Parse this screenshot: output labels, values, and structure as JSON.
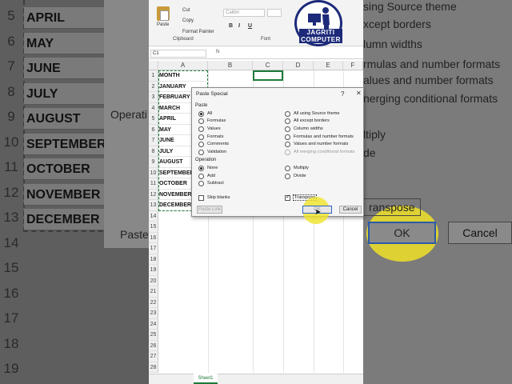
{
  "background": {
    "row_numbers": [
      "5",
      "6",
      "7",
      "8",
      "9",
      "10",
      "11",
      "12",
      "13",
      "14",
      "15",
      "16",
      "17",
      "18",
      "19",
      "20"
    ],
    "months": [
      "APRIL",
      "MAY",
      "JUNE",
      "JULY",
      "AUGUST",
      "SEPTEMBER",
      "OCTOBER",
      "NOVEMBER",
      "DECEMBER"
    ],
    "right_texts": [
      "sing Source theme",
      "xcept borders",
      "lumn widths",
      "rmulas and number formats",
      "alues and number formats",
      "nerging conditional formats",
      "ltiply",
      "de"
    ],
    "rbox": "ranspose",
    "ok": "OK",
    "cancel": "Cancel",
    "left_fragments": [
      "Operati",
      "Paste"
    ]
  },
  "ribbon": {
    "cut": "Cut",
    "copy": "Copy",
    "paste": "Paste",
    "format_painter": "Format Painter",
    "clipboard_group": "Clipboard",
    "font_group": "Font",
    "font_name": "Calibri",
    "bold": "B",
    "italic": "I",
    "underline": "U"
  },
  "logo": {
    "line1": "JAGRITI",
    "line2": "COMPUTER"
  },
  "formula_bar": {
    "name_box": "C1",
    "fx": "fx"
  },
  "columns": [
    "A",
    "B",
    "C",
    "D",
    "E",
    "F"
  ],
  "rows": [
    "1",
    "2",
    "3",
    "4",
    "5",
    "6",
    "7",
    "8",
    "9",
    "10",
    "11",
    "12",
    "13",
    "14",
    "15",
    "16",
    "17",
    "18",
    "19",
    "20",
    "21",
    "22",
    "23",
    "24",
    "25",
    "26",
    "27",
    "28"
  ],
  "cells_a": [
    "MONTH",
    "JANUARY",
    "FEBRUARY",
    "MARCH",
    "APRIL",
    "MAY",
    "JUNE",
    "JULY",
    "AUGUST",
    "SEPTEMBER",
    "OCTOBER",
    "NOVEMBER",
    "DECEMBER"
  ],
  "sheet_tab": "Sheet1",
  "dialog": {
    "title": "Paste Special",
    "help": "?",
    "close": "✕",
    "paste_label": "Paste",
    "paste_left": [
      "All",
      "Formulas",
      "Values",
      "Formats",
      "Comments",
      "Validation"
    ],
    "paste_right": [
      "All using Source theme",
      "All except borders",
      "Column widths",
      "Formulas and number formats",
      "Values and number formats",
      "All merging conditional formats"
    ],
    "paste_selected": "All",
    "operation_label": "Operation",
    "op_left": [
      "None",
      "Add",
      "Subtract"
    ],
    "op_right": [
      "Multiply",
      "Divide"
    ],
    "op_selected": "None",
    "skip_blanks": "Skip blanks",
    "transpose": "Transpose",
    "transpose_checked": true,
    "paste_link": "Paste Link",
    "ok": "OK",
    "cancel": "Cancel"
  }
}
